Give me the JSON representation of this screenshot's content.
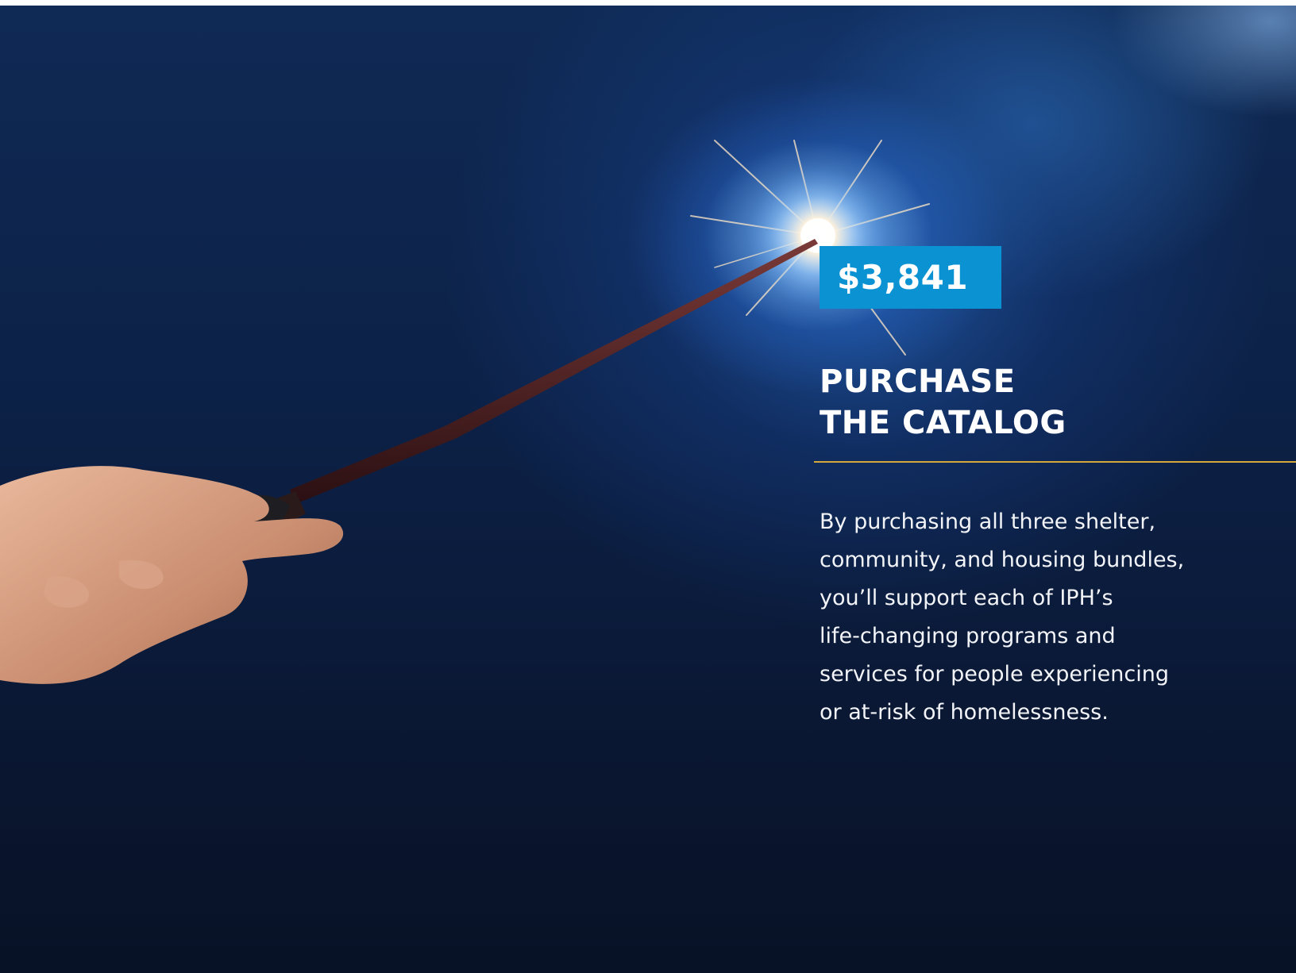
{
  "price": {
    "amount": "$3,841"
  },
  "headline": {
    "lines": [
      "PURCHASE",
      "THE CATALOG"
    ]
  },
  "body": {
    "lines": [
      "By purchasing all three shelter,",
      "community, and housing bundles,",
      "you’ll support each of IPH’s",
      "life-changing programs and",
      "services for people experiencing",
      "or at-risk of homelessness."
    ]
  },
  "colors": {
    "price_box": "#0a92d3",
    "divider": "#d4a83a",
    "background": "#0c2045"
  }
}
